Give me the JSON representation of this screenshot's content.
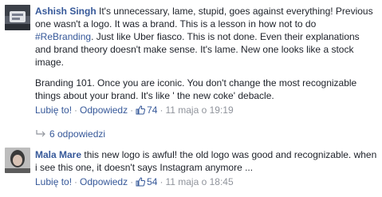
{
  "comments": [
    {
      "author": "Ashish Singh",
      "text_pre": "It's unnecessary, lame, stupid, goes against everything! Previous one wasn't a logo. It was a brand. This is a lesson in how not to do ",
      "hashtag": "#ReBranding",
      "text_post": ". Just like Uber fiasco. This is not done. Even their explanations and brand theory doesn't make sense. It's lame. New one looks like a stock image.",
      "text2": "Branding 101. Once you are iconic. You don't change the most recognizable things about your brand. It's like ' the new coke' debacle.",
      "like_label": "Lubię to!",
      "reply_label": "Odpowiedz",
      "like_count": "74",
      "timestamp": "11 maja o 19:19"
    },
    {
      "author": "Mala Mare",
      "text": "this new logo is awful! the old logo was good and recognizable. when i see this one, it doesn't says Instagram anymore ...",
      "like_label": "Lubię to!",
      "reply_label": "Odpowiedz",
      "like_count": "54",
      "timestamp": "11 maja o 18:45"
    }
  ],
  "replies_link": "6 odpowiedzi",
  "separator": "·",
  "icons": [
    "thumbs-up-icon",
    "reply-arrow-icon",
    "avatar-icon"
  ]
}
